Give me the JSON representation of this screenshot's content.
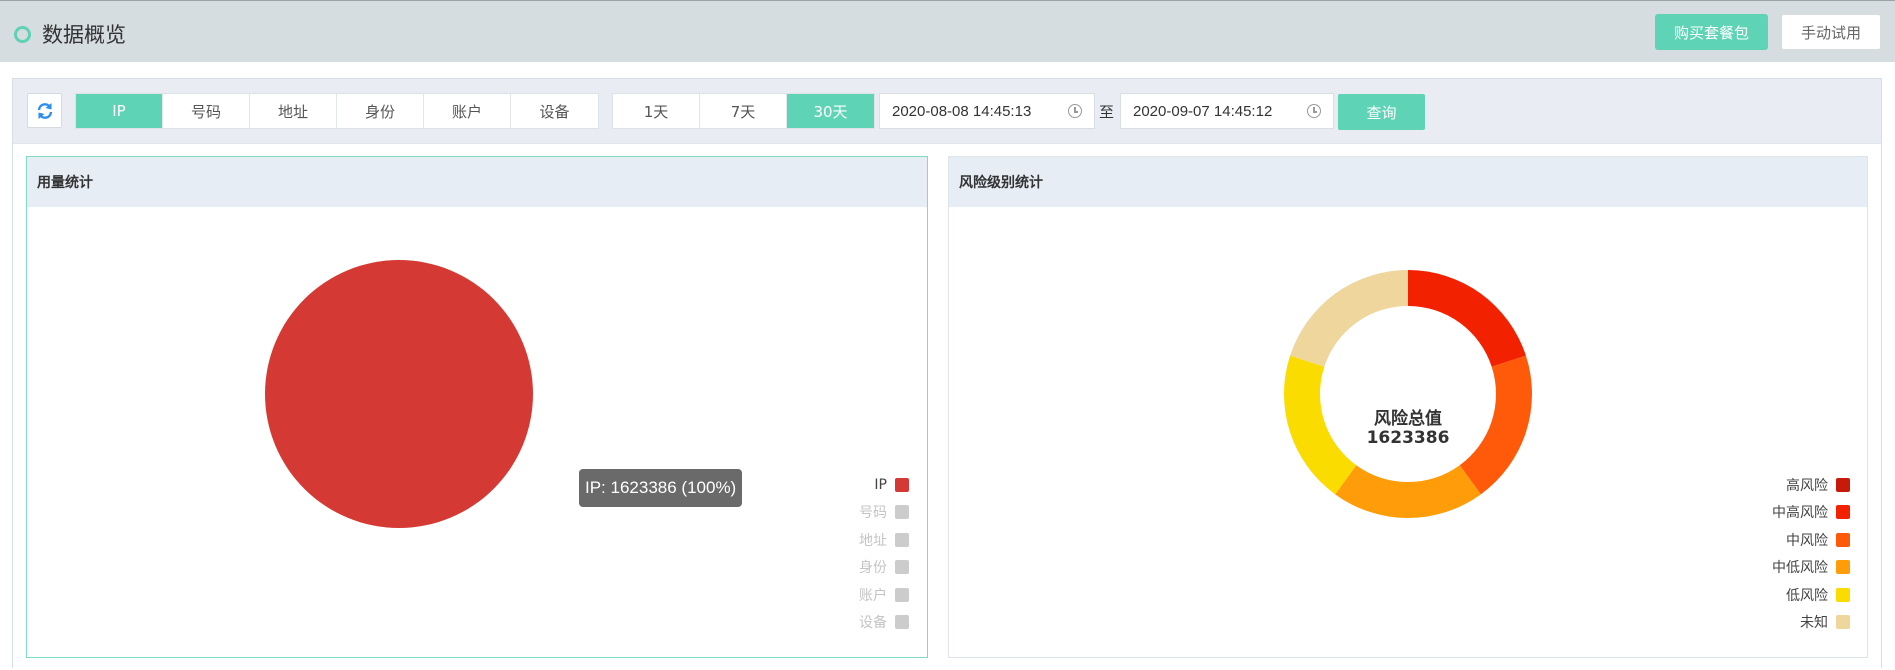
{
  "header": {
    "title": "数据概览",
    "buy_button": "购买套餐包",
    "trial_button": "手动试用"
  },
  "toolbar": {
    "refresh_icon": "refresh-icon",
    "types": [
      "IP",
      "号码",
      "地址",
      "身份",
      "账户",
      "设备"
    ],
    "active_type": "IP",
    "ranges": [
      "1天",
      "7天",
      "30天"
    ],
    "active_range": "30天",
    "start_date": "2020-08-08 14:45:13",
    "separator": "至",
    "end_date": "2020-09-07 14:45:12",
    "query_button": "查询"
  },
  "usage_card": {
    "title": "用量统计",
    "tooltip": "IP: 1623386 (100%)",
    "legend": [
      {
        "label": "IP",
        "color": "#d43a33",
        "active": true
      },
      {
        "label": "号码",
        "color": "#cccccc",
        "active": false
      },
      {
        "label": "地址",
        "color": "#cccccc",
        "active": false
      },
      {
        "label": "身份",
        "color": "#cccccc",
        "active": false
      },
      {
        "label": "账户",
        "color": "#cccccc",
        "active": false
      },
      {
        "label": "设备",
        "color": "#cccccc",
        "active": false
      }
    ]
  },
  "risk_card": {
    "title": "风险级别统计",
    "center_label": "风险总值",
    "center_value": "1623386",
    "legend": [
      {
        "label": "高风险",
        "color": "#c81a08"
      },
      {
        "label": "中高风险",
        "color": "#f22200"
      },
      {
        "label": "中风险",
        "color": "#ff5a0a"
      },
      {
        "label": "中低风险",
        "color": "#ff9c0a"
      },
      {
        "label": "低风险",
        "color": "#fadc00"
      },
      {
        "label": "未知",
        "color": "#efd69c"
      }
    ]
  },
  "chart_data": [
    {
      "type": "pie",
      "title": "用量统计",
      "categories": [
        "IP",
        "号码",
        "地址",
        "身份",
        "账户",
        "设备"
      ],
      "values": [
        1623386,
        0,
        0,
        0,
        0,
        0
      ]
    },
    {
      "type": "pie",
      "title": "风险级别统计",
      "categories": [
        "高风险",
        "中高风险",
        "中风险",
        "中低风险",
        "低风险",
        "未知"
      ],
      "values": [
        0,
        20,
        20,
        20,
        20,
        20
      ],
      "colors": [
        "#c81a08",
        "#f22200",
        "#ff5a0a",
        "#ff9c0a",
        "#fadc00",
        "#efd69c"
      ],
      "donut": true,
      "total": 1623386
    }
  ]
}
